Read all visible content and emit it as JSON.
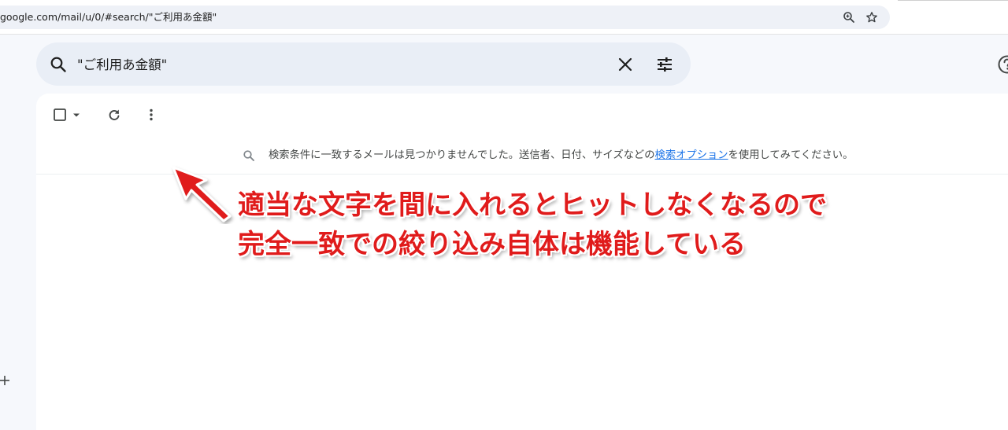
{
  "browser": {
    "url": "google.com/mail/u/0/#search/\"ご利用あ金額\""
  },
  "search": {
    "query": "\"ご利用あ金額\""
  },
  "message": {
    "text_before": "検索条件に一致するメールは見つかりませんでした。送信者、日付、サイズなどの",
    "link_text": "検索オプション",
    "text_after": "を使用してみてください。"
  },
  "annotation": {
    "line1": "適当な文字を間に入れるとヒットしなくなるので",
    "line2": "完全一致での絞り込み自体は機能している"
  },
  "colors": {
    "accent_link": "#1a73e8",
    "annotation_red": "#e01b1b",
    "searchbar_bg": "#e9eef6"
  },
  "icons": {
    "zoom": "zoom-icon",
    "bookmark": "star-icon",
    "search": "search-icon",
    "clear": "close-icon",
    "options": "tune-icon",
    "help": "help-icon",
    "select": "checkbox-icon",
    "refresh": "refresh-icon",
    "more": "more-vert-icon",
    "compose_label": "plus-icon"
  }
}
